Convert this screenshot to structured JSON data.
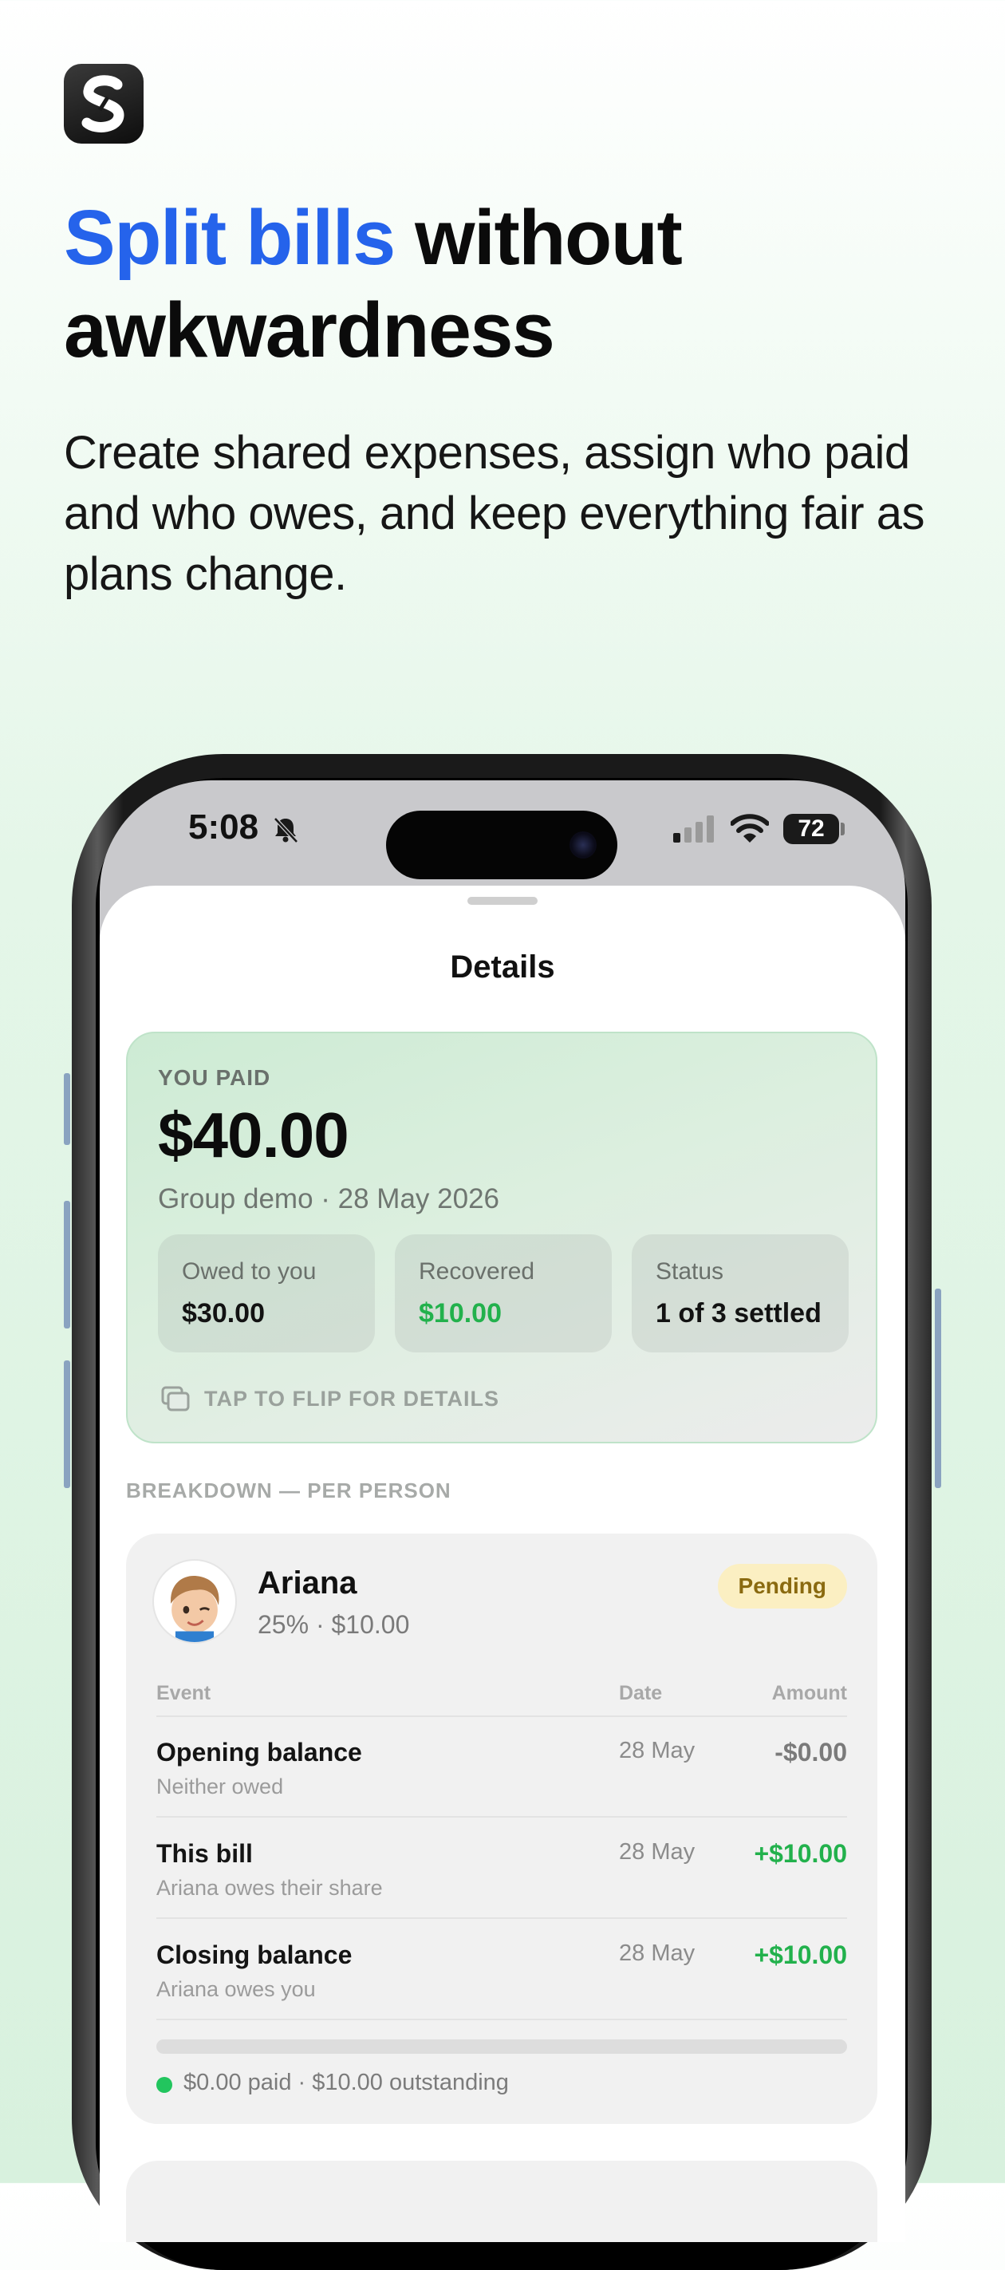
{
  "hero": {
    "headline_accent": "Split bills",
    "headline_rest_line1": " without",
    "headline_line2": "awkwardness",
    "subhead": "Create shared expenses, assign who paid and who owes, and keep everything fair as plans change.",
    "accent_color": "#2563eb"
  },
  "status_bar": {
    "time": "5:08",
    "battery": "72",
    "icons": [
      "bell-slash-icon",
      "cellular-signal-icon",
      "wifi-icon",
      "battery-icon"
    ]
  },
  "sheet": {
    "title": "Details"
  },
  "summary": {
    "label": "YOU PAID",
    "amount": "$40.00",
    "meta": "Group demo · 28 May 2026",
    "stats": [
      {
        "label": "Owed to you",
        "value": "$30.00"
      },
      {
        "label": "Recovered",
        "value": "$10.00"
      },
      {
        "label": "Status",
        "value": "1 of 3 settled"
      }
    ],
    "flip_hint": "TAP TO FLIP FOR DETAILS"
  },
  "breakdown": {
    "section_label": "BREAKDOWN — PER PERSON",
    "person": {
      "name": "Ariana",
      "share": "25% · $10.00",
      "badge": "Pending",
      "columns": {
        "event": "Event",
        "date": "Date",
        "amount": "Amount"
      },
      "rows": [
        {
          "title": "Opening balance",
          "subtitle": "Neither owed",
          "date": "28 May",
          "amount": "-$0.00",
          "tone": "neutral"
        },
        {
          "title": "This bill",
          "subtitle": "Ariana owes their share",
          "date": "28 May",
          "amount": "+$10.00",
          "tone": "positive"
        },
        {
          "title": "Closing balance",
          "subtitle": "Ariana owes you",
          "date": "28 May",
          "amount": "+$10.00",
          "tone": "positive"
        }
      ],
      "progress_fraction": 0.0,
      "progress_text": "$0.00 paid · $10.00 outstanding"
    }
  },
  "colors": {
    "positive": "#22b14c",
    "neutral": "#7a7a7a",
    "pending_bg": "#fbefc2"
  }
}
